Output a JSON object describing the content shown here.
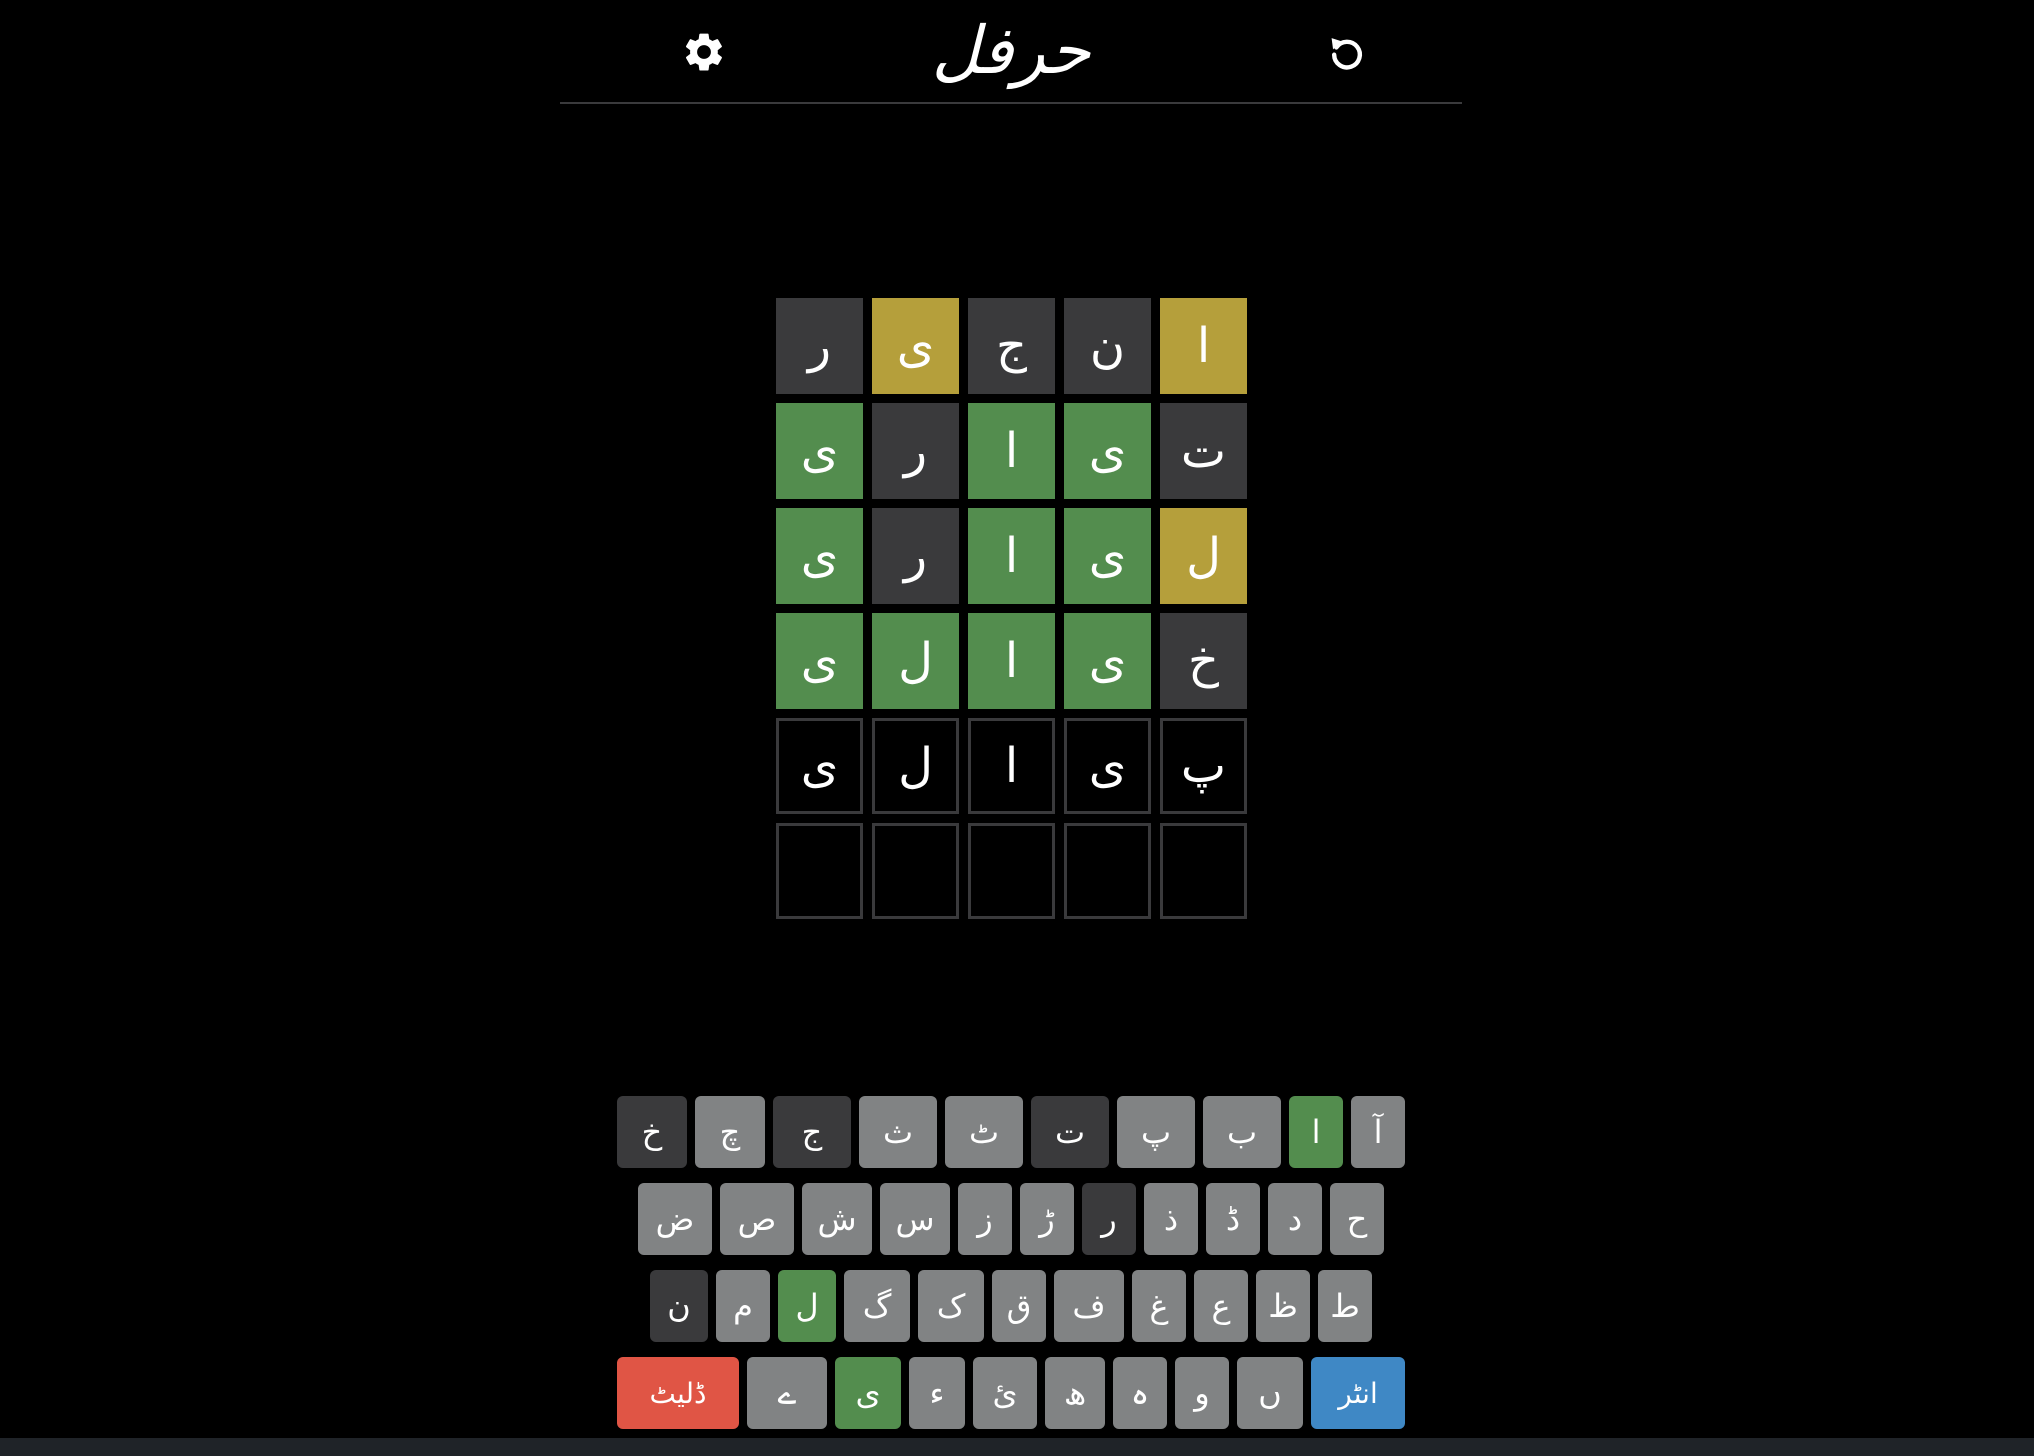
{
  "header": {
    "title": "حرفل",
    "settings_icon": "gear-icon",
    "reset_icon": "undo-icon"
  },
  "colors": {
    "correct": "#538d4e",
    "present": "#b59f3b",
    "absent": "#3a3a3c",
    "key": "#818384",
    "enter": "#3f88c5",
    "delete": "#e05545"
  },
  "board": {
    "rows": [
      {
        "tiles": [
          {
            "letter": "ا",
            "state": "present"
          },
          {
            "letter": "ن",
            "state": "absent"
          },
          {
            "letter": "ج",
            "state": "absent"
          },
          {
            "letter": "ی",
            "state": "present"
          },
          {
            "letter": "ر",
            "state": "absent"
          }
        ]
      },
      {
        "tiles": [
          {
            "letter": "ت",
            "state": "absent"
          },
          {
            "letter": "ی",
            "state": "correct"
          },
          {
            "letter": "ا",
            "state": "correct"
          },
          {
            "letter": "ر",
            "state": "absent"
          },
          {
            "letter": "ی",
            "state": "correct"
          }
        ]
      },
      {
        "tiles": [
          {
            "letter": "ل",
            "state": "present"
          },
          {
            "letter": "ی",
            "state": "correct"
          },
          {
            "letter": "ا",
            "state": "correct"
          },
          {
            "letter": "ر",
            "state": "absent"
          },
          {
            "letter": "ی",
            "state": "correct"
          }
        ]
      },
      {
        "tiles": [
          {
            "letter": "خ",
            "state": "absent"
          },
          {
            "letter": "ی",
            "state": "correct"
          },
          {
            "letter": "ا",
            "state": "correct"
          },
          {
            "letter": "ل",
            "state": "correct"
          },
          {
            "letter": "ی",
            "state": "correct"
          }
        ]
      },
      {
        "tiles": [
          {
            "letter": "پ",
            "state": "empty"
          },
          {
            "letter": "ی",
            "state": "empty"
          },
          {
            "letter": "ا",
            "state": "empty"
          },
          {
            "letter": "ل",
            "state": "empty"
          },
          {
            "letter": "ی",
            "state": "empty"
          }
        ]
      },
      {
        "tiles": [
          {
            "letter": "",
            "state": "empty"
          },
          {
            "letter": "",
            "state": "empty"
          },
          {
            "letter": "",
            "state": "empty"
          },
          {
            "letter": "",
            "state": "empty"
          },
          {
            "letter": "",
            "state": "empty"
          }
        ]
      }
    ]
  },
  "keyboard": {
    "rows": [
      [
        {
          "label": "آ",
          "state": "unused"
        },
        {
          "label": "ا",
          "state": "correct"
        },
        {
          "label": "ب",
          "state": "unused"
        },
        {
          "label": "پ",
          "state": "unused"
        },
        {
          "label": "ت",
          "state": "absent"
        },
        {
          "label": "ٹ",
          "state": "unused"
        },
        {
          "label": "ث",
          "state": "unused"
        },
        {
          "label": "ج",
          "state": "absent"
        },
        {
          "label": "چ",
          "state": "unused"
        },
        {
          "label": "خ",
          "state": "absent"
        }
      ],
      [
        {
          "label": "ح",
          "state": "unused"
        },
        {
          "label": "د",
          "state": "unused"
        },
        {
          "label": "ڈ",
          "state": "unused"
        },
        {
          "label": "ذ",
          "state": "unused"
        },
        {
          "label": "ر",
          "state": "absent"
        },
        {
          "label": "ڑ",
          "state": "unused"
        },
        {
          "label": "ز",
          "state": "unused"
        },
        {
          "label": "س",
          "state": "unused"
        },
        {
          "label": "ش",
          "state": "unused"
        },
        {
          "label": "ص",
          "state": "unused"
        },
        {
          "label": "ض",
          "state": "unused"
        }
      ],
      [
        {
          "label": "ط",
          "state": "unused"
        },
        {
          "label": "ظ",
          "state": "unused"
        },
        {
          "label": "ع",
          "state": "unused"
        },
        {
          "label": "غ",
          "state": "unused"
        },
        {
          "label": "ف",
          "state": "unused"
        },
        {
          "label": "ق",
          "state": "unused"
        },
        {
          "label": "ک",
          "state": "unused"
        },
        {
          "label": "گ",
          "state": "unused"
        },
        {
          "label": "ل",
          "state": "correct"
        },
        {
          "label": "م",
          "state": "unused"
        },
        {
          "label": "ن",
          "state": "absent"
        }
      ],
      [
        {
          "label": "انٹر",
          "state": "enter"
        },
        {
          "label": "ں",
          "state": "unused"
        },
        {
          "label": "و",
          "state": "unused"
        },
        {
          "label": "ہ",
          "state": "unused"
        },
        {
          "label": "ھ",
          "state": "unused"
        },
        {
          "label": "ئ",
          "state": "unused"
        },
        {
          "label": "ء",
          "state": "unused"
        },
        {
          "label": "ی",
          "state": "correct"
        },
        {
          "label": "ے",
          "state": "unused"
        },
        {
          "label": "ڈلیٹ",
          "state": "delete"
        }
      ]
    ]
  }
}
